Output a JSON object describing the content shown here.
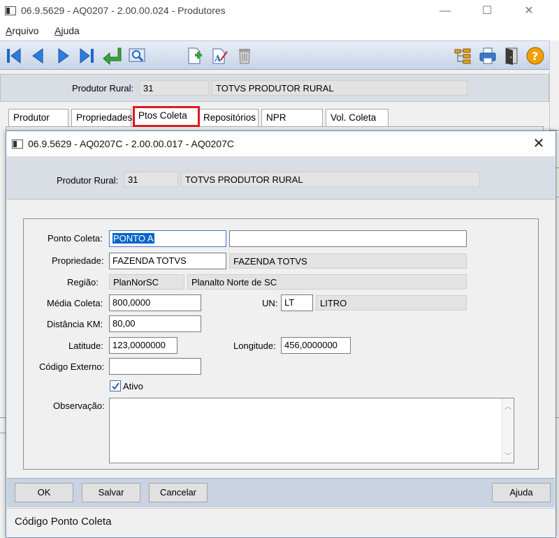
{
  "main_window": {
    "title": "06.9.5629 - AQ0207 - 2.00.00.024 - Produtores",
    "menu": [
      {
        "label": "Arquivo",
        "mnemonic": "A",
        "rest": "rquivo"
      },
      {
        "label": "Ajuda",
        "mnemonic": "A",
        "rest": "juda"
      }
    ],
    "toolbar_icons": [
      "first-record-icon",
      "previous-record-icon",
      "next-record-icon",
      "last-record-icon",
      "confirm-return-icon",
      "zoom-search-icon",
      "new-document-icon",
      "edit-document-icon",
      "delete-trash-icon",
      "tree-structure-icon",
      "print-icon",
      "exit-door-icon",
      "help-icon"
    ],
    "produtor_label": "Produtor Rural:",
    "produtor_code": "31",
    "produtor_name": "TOTVS PRODUTOR RURAL",
    "tabs": [
      {
        "label": "Produtor",
        "active": false
      },
      {
        "label": "Propriedades",
        "active": false
      },
      {
        "label": "Ptos Coleta",
        "active": true
      },
      {
        "label": "Repositórios",
        "active": false
      },
      {
        "label": "NPR",
        "active": false
      },
      {
        "label": "Vol. Coleta",
        "active": false
      }
    ]
  },
  "dialog": {
    "title": "06.9.5629 - AQ0207C - 2.00.00.017 - AQ0207C",
    "produtor_label": "Produtor Rural:",
    "produtor_code": "31",
    "produtor_name": "TOTVS PRODUTOR RURAL",
    "form": {
      "ponto_coleta": {
        "label": "Ponto Coleta:",
        "value": "PONTO A",
        "description": ""
      },
      "propriedade": {
        "label": "Propriedade:",
        "value": "FAZENDA TOTVS",
        "description": "FAZENDA TOTVS"
      },
      "regiao": {
        "label": "Região:",
        "value": "PlanNorSC",
        "description": "Planalto Norte de SC"
      },
      "media_coleta": {
        "label": "Média Coleta:",
        "value": "800,0000"
      },
      "un": {
        "label": "UN:",
        "value": "LT",
        "description": "LITRO"
      },
      "distancia": {
        "label": "Distância KM:",
        "value": "80,00"
      },
      "latitude": {
        "label": "Latitude:",
        "value": "123,0000000"
      },
      "longitude": {
        "label": "Longitude:",
        "value": "456,0000000"
      },
      "codigo_externo": {
        "label": "Código Externo:",
        "value": ""
      },
      "ativo": {
        "label": "Ativo",
        "checked": true
      },
      "observacao": {
        "label": "Observação:",
        "value": ""
      }
    },
    "buttons": {
      "ok": "OK",
      "salvar": "Salvar",
      "cancelar": "Cancelar",
      "ajuda": "Ajuda"
    },
    "status": "Código Ponto Coleta"
  },
  "colors": {
    "toolbar_icon_blue": "#1f64c8",
    "active_tab_highlight": "#e0171d",
    "selection": "#0a64c8",
    "help_orange": "#f0a000"
  }
}
